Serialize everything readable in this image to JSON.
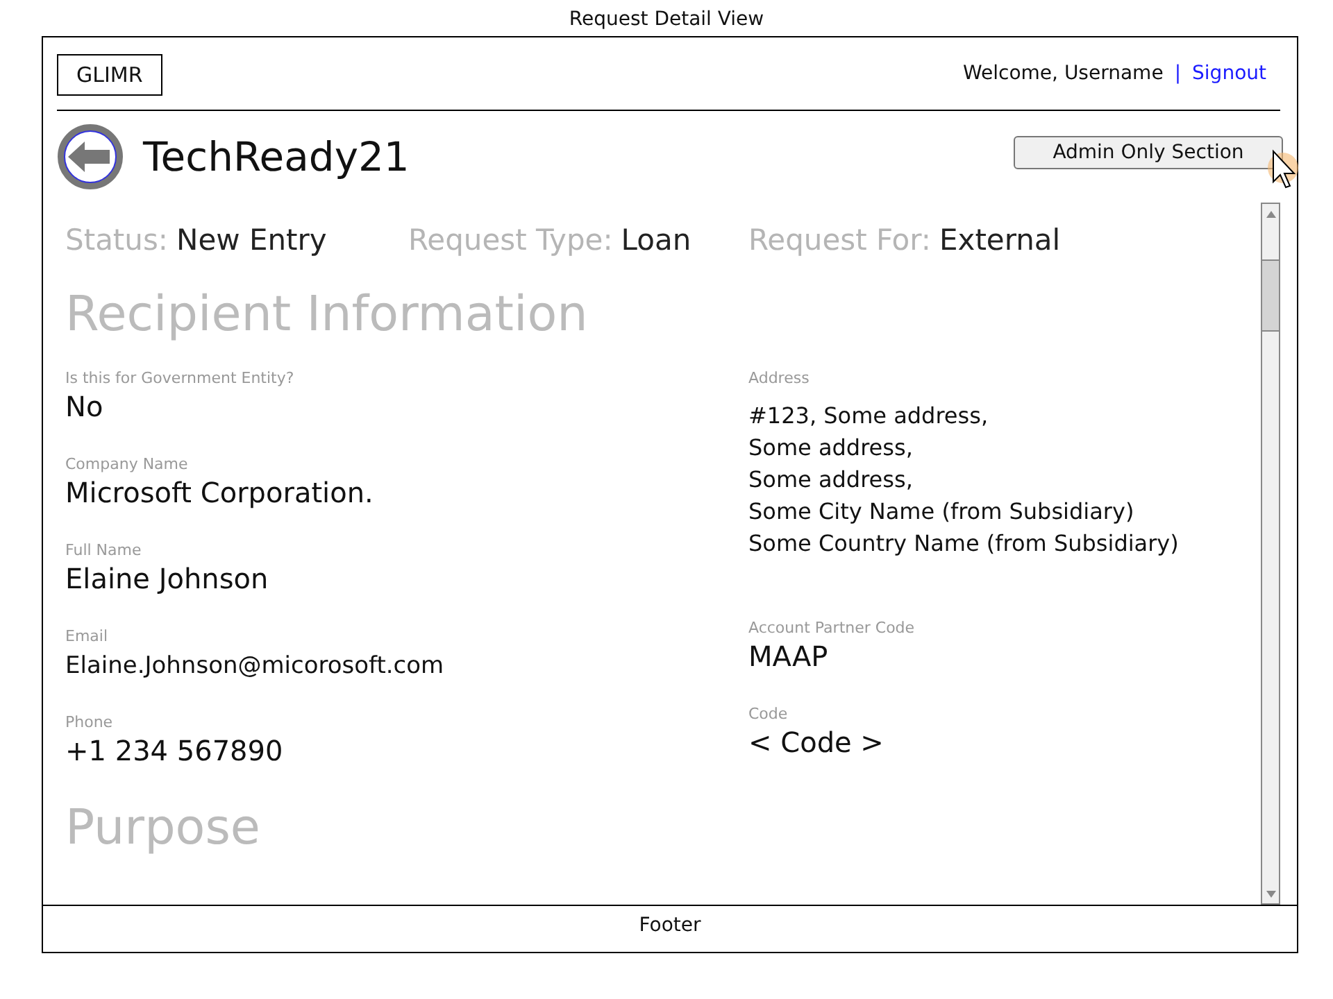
{
  "window": {
    "title": "Request Detail View"
  },
  "header": {
    "logo": "GLIMR",
    "welcome": "Welcome, Username",
    "separator": "|",
    "signout": "Signout"
  },
  "page": {
    "title": "TechReady21",
    "admin_button": "Admin Only Section"
  },
  "summary": [
    {
      "label": "Status:",
      "value": "New Entry"
    },
    {
      "label": "Request Type:",
      "value": "Loan"
    },
    {
      "label": "Request For:",
      "value": "External"
    }
  ],
  "recipient": {
    "heading": "Recipient Information",
    "left_fields": [
      {
        "label": "Is this for Government Entity?",
        "value": "No",
        "kind": "large"
      },
      {
        "label": "Company  Name",
        "value": "Microsoft Corporation.",
        "kind": "large"
      },
      {
        "label": "Full Name",
        "value": "Elaine Johnson",
        "kind": "large"
      },
      {
        "label": "Email",
        "value": "Elaine.Johnson@micorosoft.com",
        "kind": "small"
      },
      {
        "label": "Phone",
        "value": "+1 234 567890",
        "kind": "large"
      }
    ],
    "right_fields": [
      {
        "label": "Address",
        "kind": "multiline",
        "lines": [
          "#123, Some address,",
          "Some address,",
          "Some address,",
          "Some City Name (from Subsidiary)",
          "Some Country Name (from Subsidiary)"
        ]
      },
      {
        "label": "Account Partner Code",
        "value": "MAAP",
        "kind": "large"
      },
      {
        "label": "Code",
        "value": "< Code >",
        "kind": "large"
      }
    ]
  },
  "purpose": {
    "heading": "Purpose"
  },
  "footer": {
    "text": "Footer"
  }
}
